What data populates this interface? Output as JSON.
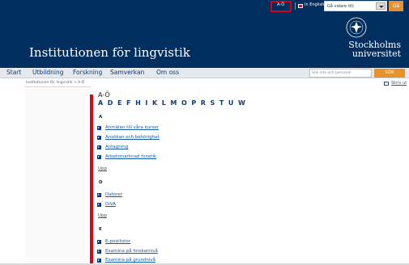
{
  "topbar": {
    "az_link": "A-Ö",
    "english_link": "In English",
    "goto_placeholder": "Gå vidare till:",
    "goto_button": "Gå"
  },
  "header": {
    "department": "Institutionen för lingvistik",
    "university_line1": "Stockholms",
    "university_line2": "universitet"
  },
  "nav": {
    "items": [
      "Start",
      "Utbildning",
      "Forskning",
      "Samverkan",
      "Om oss"
    ],
    "search_placeholder": "Sök info och personal",
    "search_button": "SÖK"
  },
  "breadcrumb": "Institutionen för lingvistik > A-Ö",
  "print_label": "Skriv ut",
  "content": {
    "heading": "A-Ö",
    "letter_index": "A D E F H I K L M O P R S T U W",
    "sections": [
      {
        "letter": "A",
        "items": [
          "Anmälan till våra kurser",
          "Ansökan och behörighet",
          "Antagning",
          "Arbetsmarknad fonetik"
        ],
        "upp": "Upp"
      },
      {
        "letter": "D",
        "items": [
          "Datorer",
          "DiVA"
        ],
        "upp": "Upp"
      },
      {
        "letter": "E",
        "items": [
          "E-postlistor",
          "Examina på forskarnivå",
          "Examina på grundnivå"
        ]
      }
    ]
  },
  "colors": {
    "header_bg": "#002f5f",
    "accent_orange": "#e8902a",
    "highlight_red": "#e0001a",
    "link_blue": "#1a5aa0"
  }
}
